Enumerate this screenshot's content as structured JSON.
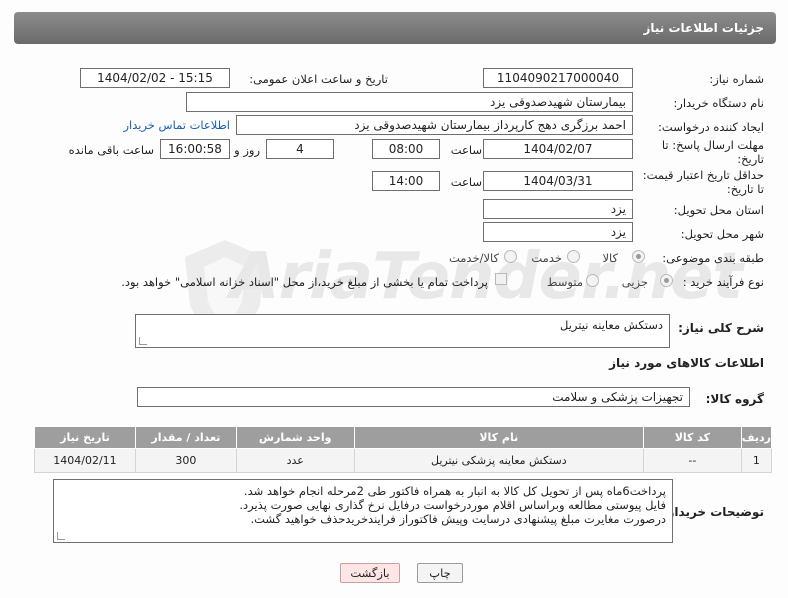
{
  "header": {
    "title": "جزئیات اطلاعات نیاز"
  },
  "form": {
    "need_number_label": "شماره نیاز:",
    "need_number": "1104090217000040",
    "announce_label": "تاریخ و ساعت اعلان عمومی:",
    "announce_value": "1404/02/02 - 15:15",
    "buyer_org_label": "نام دستگاه خریدار:",
    "buyer_org": "بیمارستان شهیدصدوقی یزد",
    "requester_label": "ایجاد کننده درخواست:",
    "requester": "احمد برزگری دهج کارپرداز بیمارستان شهیدصدوقی یزد",
    "contact_link": "اطلاعات تماس خریدار",
    "deadline_label_1": "مهلت ارسال پاسخ: تا",
    "deadline_label_2": "تاریخ:",
    "deadline_date": "1404/02/07",
    "time_label": "ساعت",
    "deadline_time": "08:00",
    "days_value": "4",
    "days_label": "روز و",
    "remaining_time": "16:00:58",
    "remaining_label": "ساعت باقی مانده",
    "validity_label_1": "حداقل تاریخ اعتبار قیمت:",
    "validity_label_2": "تا تاریخ:",
    "validity_date": "1404/03/31",
    "validity_time": "14:00",
    "province_label": "استان محل تحویل:",
    "province": "یزد",
    "city_label": "شهر محل تحویل:",
    "city": "یزد",
    "category_label": "طبقه بندی موضوعی:",
    "category_options": [
      "کالا",
      "خدمت",
      "کالا/خدمت"
    ],
    "category_selected": "کالا",
    "process_label": "نوع فرآیند خرید :",
    "process_options": [
      "جزیی",
      "متوسط"
    ],
    "process_selected": "جزیی",
    "payment_note": "پرداخت تمام یا بخشی از مبلغ خرید،از محل \"اسناد خزانه اسلامی\" خواهد بود."
  },
  "summary": {
    "label": "شرح کلی نیاز:",
    "value": "دستکش معاینه نیتریل"
  },
  "goods_info": {
    "title": "اطلاعات کالاهای مورد نیاز",
    "group_label": "گروه کالا:",
    "group_value": "تجهیزات پزشکی و سلامت"
  },
  "table": {
    "headers": [
      "ردیف",
      "کد کالا",
      "نام کالا",
      "واحد شمارش",
      "تعداد / مقدار",
      "تاریخ نیاز"
    ],
    "rows": [
      [
        "1",
        "--",
        "دستکش معاینه پزشکی نیتریل",
        "عدد",
        "300",
        "1404/02/11"
      ]
    ]
  },
  "buyer_notes": {
    "label": "توضیحات خریدار:",
    "lines": [
      "پرداخت6ماه پس از تحویل کل کالا به انبار به همراه فاکتور طی 2مرحله انجام خواهد شد.",
      "فایل پیوستی مطالعه وبراساس اقلام موردرخواست درفایل نرخ گذاری نهایی  صورت پذیرد.",
      "درصورت مغایرت مبلغ پیشنهادی درسایت وپیش فاکتوراز فرایندخریدحذف خواهید گشت."
    ]
  },
  "buttons": {
    "print": "چاپ",
    "back": "بازگشت"
  },
  "watermark": "AriaTender.net",
  "colors": {
    "header_bg": "#7a7a7a",
    "link": "#1a5fb4",
    "table_header": "#9e9e9e"
  }
}
